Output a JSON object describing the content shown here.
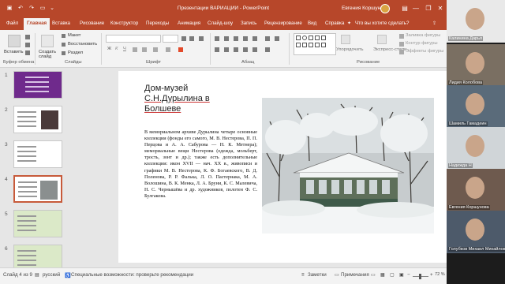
{
  "window": {
    "title": "Презентации ВАРИАЦИИ  -  PowerPoint",
    "user": "Евгения Коршунова",
    "minimize": "—",
    "restore": "❐",
    "close": "✕"
  },
  "quick_access": {
    "save_icon": "floppy-icon",
    "undo_icon": "undo-icon",
    "redo_icon": "redo-icon",
    "start_icon": "start-slideshow-icon"
  },
  "tabs": [
    "Файл",
    "Главная",
    "Вставка",
    "Рисование",
    "Конструктор",
    "Переходы",
    "Анимация",
    "Слайд-шоу",
    "Запись",
    "Рецензирование",
    "Вид",
    "Справка"
  ],
  "tell_me": "Что вы хотите сделать?",
  "ribbon": {
    "clipboard": {
      "paste": "Вставить",
      "label": "Буфер обмена"
    },
    "slides": {
      "new_slide": "Создать слайд",
      "layout": "Макет",
      "reset": "Восстановить",
      "section": "Раздел",
      "label": "Слайды"
    },
    "font": {
      "label": "Шрифт"
    },
    "paragraph": {
      "label": "Абзац"
    },
    "drawing": {
      "arrange": "Упорядочить",
      "quick_styles": "Экспресс-стили",
      "fill": "Заливка фигуры",
      "outline": "Контур фигуры",
      "effects": "Эффекты фигуры",
      "label": "Рисование"
    }
  },
  "thumbnails": [
    {
      "num": "1",
      "bg": "#6f2a8c"
    },
    {
      "num": "2",
      "bg": "#ffffff"
    },
    {
      "num": "3",
      "bg": "#ffffff"
    },
    {
      "num": "4",
      "bg": "#ffffff"
    },
    {
      "num": "5",
      "bg": "#dbe9c8"
    },
    {
      "num": "6",
      "bg": "#dbe9c8"
    }
  ],
  "slide": {
    "title_lines": [
      "Дом-музей",
      "С.Н.Дурылина в",
      "Болшеве"
    ],
    "body": "В мемориальном архиве Дурылина четыре основные коллекции (фонды его самого, М. В. Нестерова, П. П. Перцова и А. А. Сабурова — Н. К. Метнера); мемориальные вещи Нестерова (одежда, мольберт, трость, зонт и др.); также есть дополнительные коллекции: икон XVII — нач. XX в., живописи и графики М. В. Нестерова, К. Ф. Богаевского, В. Д. Поленова, Р. Р. Фалька, Л. О. Пастернака, М. А. Волошина, В. К. Менка, Л. А. Бруни, К. С. Малевича, Н. С. Чернышёва и др. художников, полотен Ф. С. Булгакова."
  },
  "status": {
    "slide_counter": "Слайд 4 из 9",
    "language": "русский",
    "accessibility": "Специальные возможности: проверьте рекомендации",
    "notes": "Заметки",
    "comments": "Примечания",
    "zoom": "72 %"
  },
  "participants": [
    {
      "name": "Калинина Дарья"
    },
    {
      "name": "Лидия Колобова"
    },
    {
      "name": "Шамиль Гамадеин"
    },
    {
      "name": "Надежда Н"
    },
    {
      "name": "Евгения Коршунова"
    },
    {
      "name": "Голубков Михаил Михайлович"
    }
  ],
  "colors": {
    "accent": "#b7472a",
    "selected_thumb": "#c75a3a"
  }
}
